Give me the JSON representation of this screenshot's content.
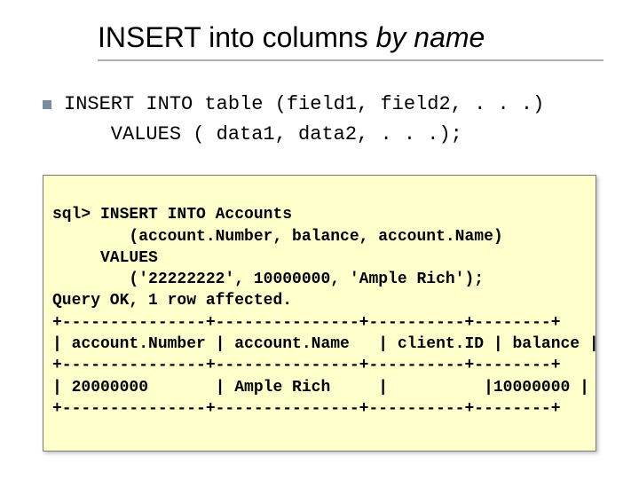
{
  "title": {
    "plain": "INSERT into columns ",
    "italic": "by name"
  },
  "syntax": {
    "line1": "INSERT INTO table (field1, field2, . . .)",
    "line2": "    VALUES ( data1, data2, . . .);"
  },
  "sqlbox": {
    "l1": "sql> INSERT INTO Accounts",
    "l2": "        (account.Number, balance, account.Name)",
    "l3": "     VALUES",
    "l4": "        ('22222222', 10000000, 'Ample Rich');",
    "l5": "Query OK, 1 row affected.",
    "l6": "+---------------+---------------+----------+--------+",
    "l7": "| account.Number | account.Name   | client.ID | balance |",
    "l8": "+---------------+---------------+----------+--------+",
    "l9": "| 20000000       | Ample Rich     |          |10000000 |",
    "l10": "+---------------+---------------+----------+--------+"
  }
}
